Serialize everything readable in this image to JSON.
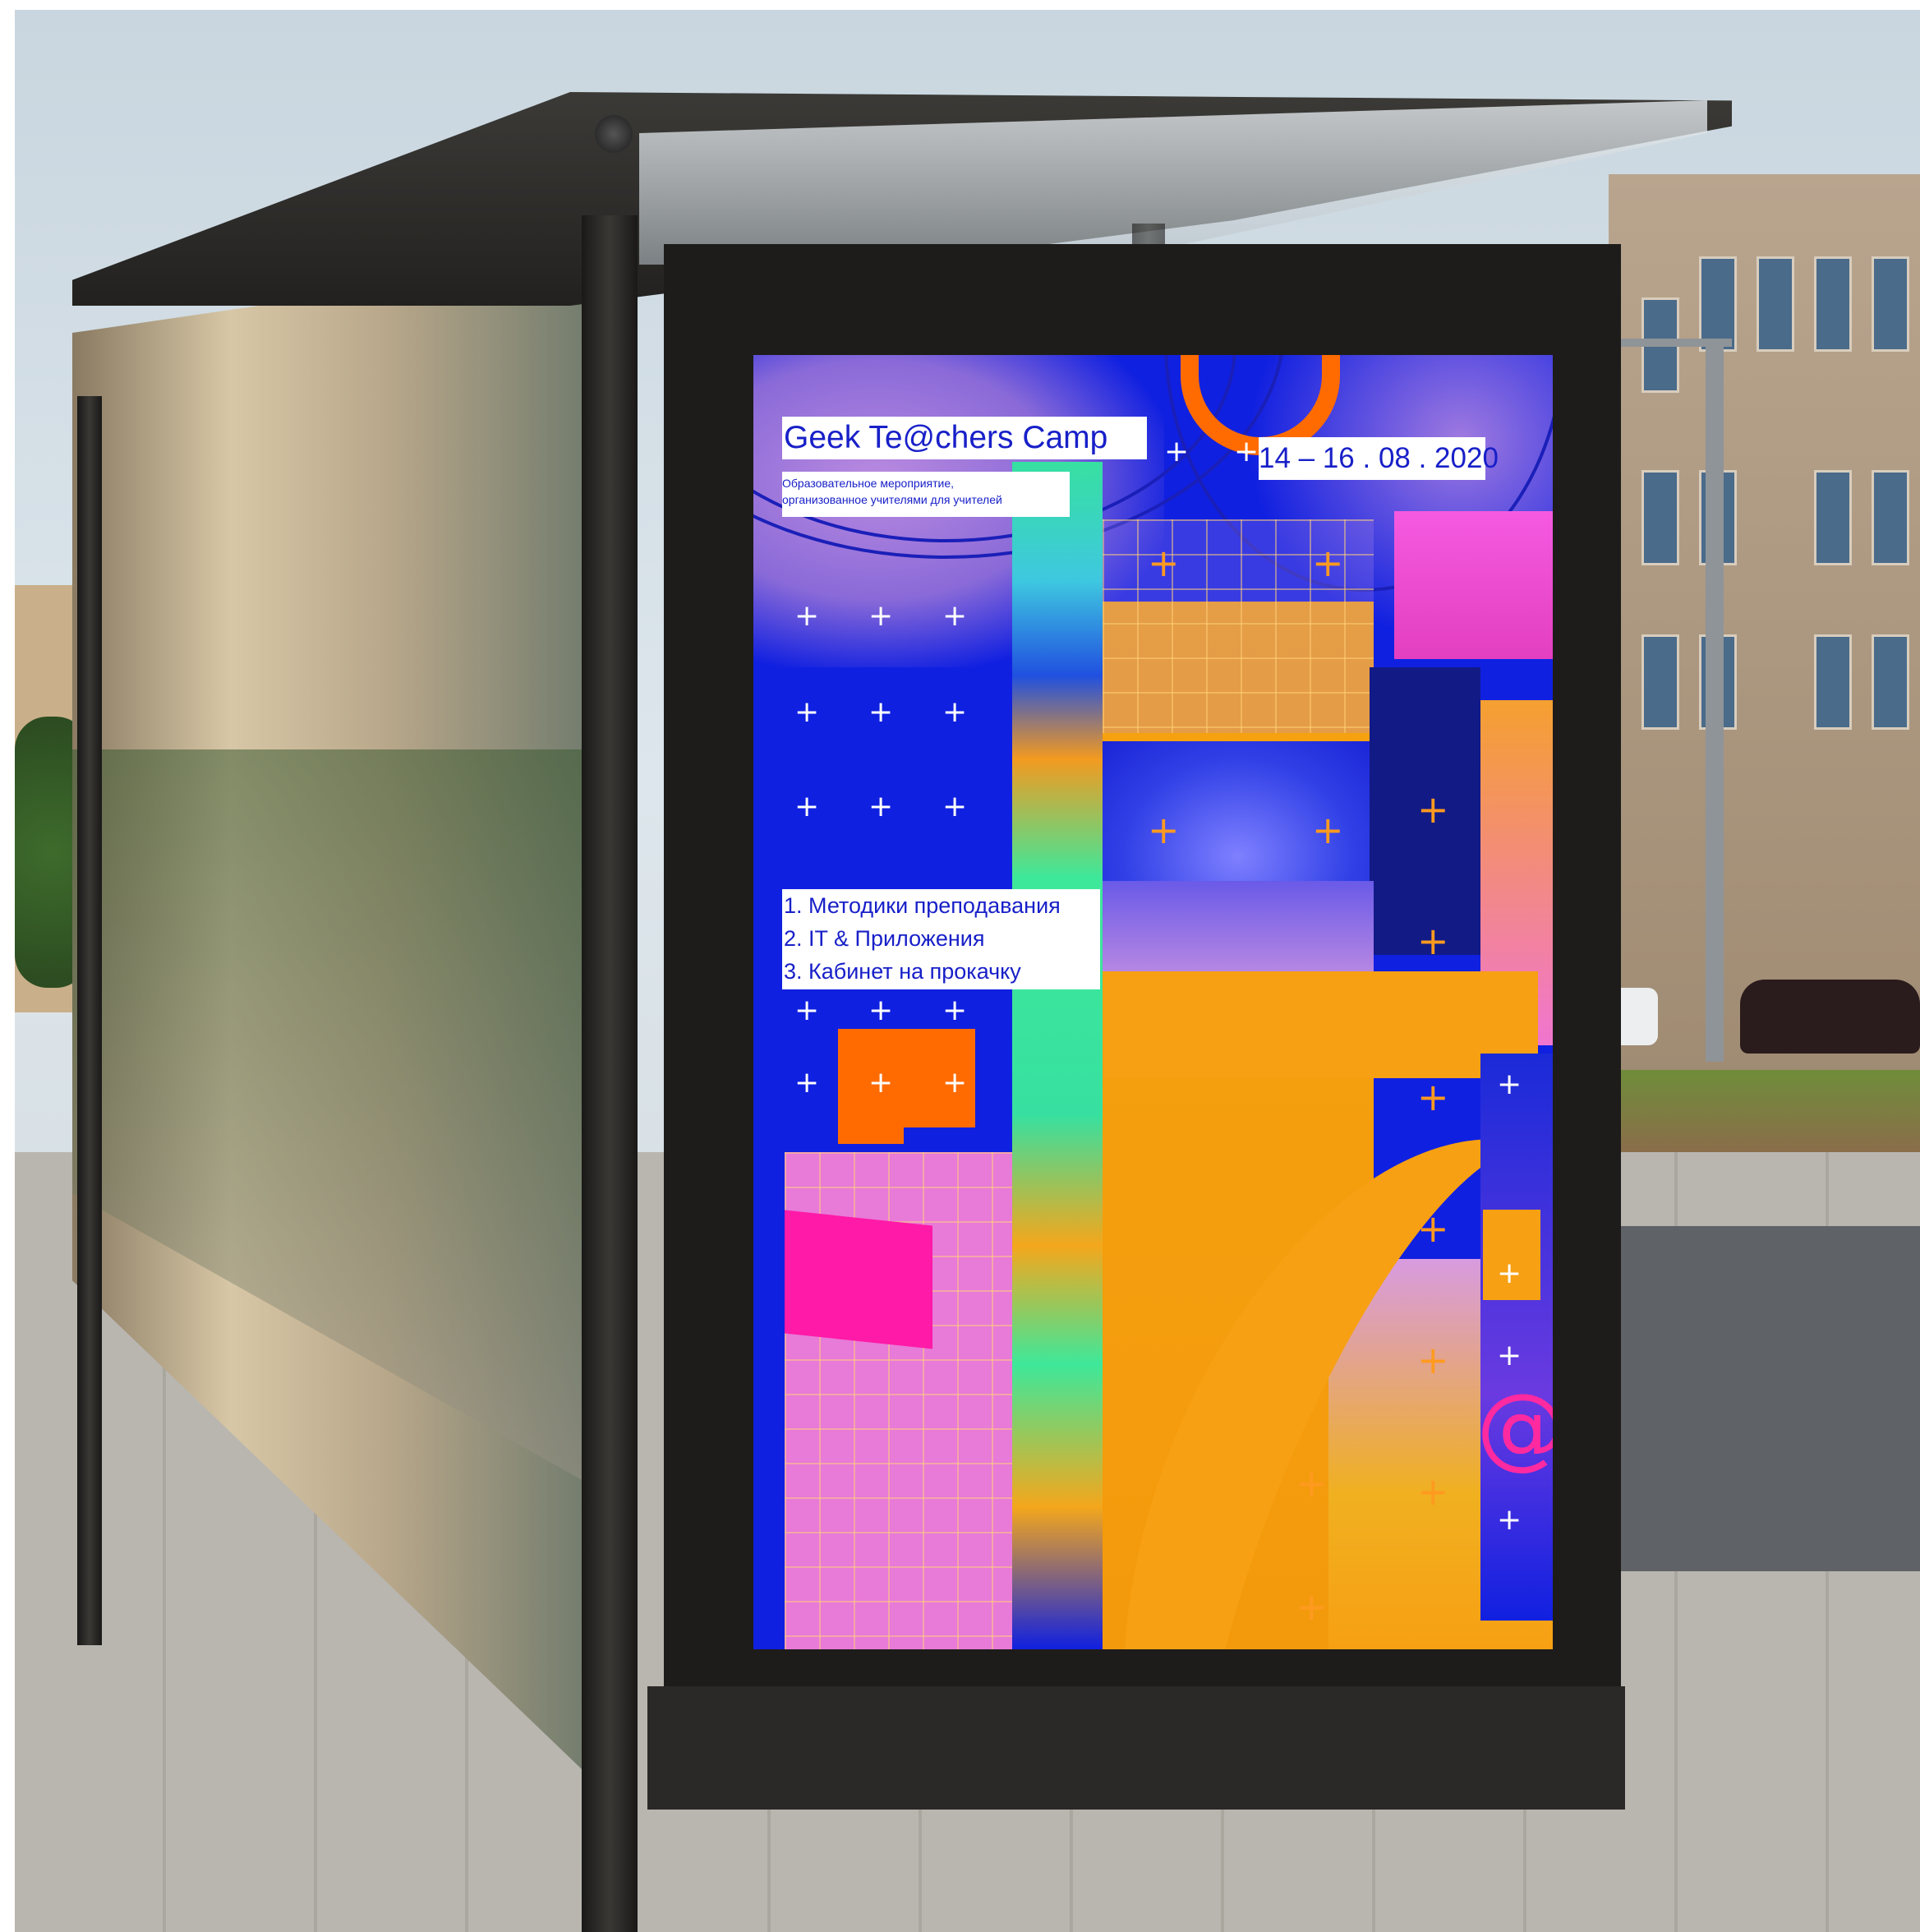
{
  "poster": {
    "title": "Geek Te@chers Camp",
    "dates": "14 – 16 . 08 . 2020",
    "subtitle_line1": "Образовательное мероприятие,",
    "subtitle_line2": "организованное учителями для учителей",
    "topics": [
      "1. Методики преподавания",
      "2. IT & Приложения",
      "3. Кабинет на прокачку"
    ],
    "at_symbol": "@"
  },
  "colors": {
    "poster_blue": "#1020e0",
    "poster_orange": "#f7a013",
    "poster_pink": "#ff1aa8",
    "poster_green": "#37e0a0",
    "label_text": "#1820c8"
  }
}
